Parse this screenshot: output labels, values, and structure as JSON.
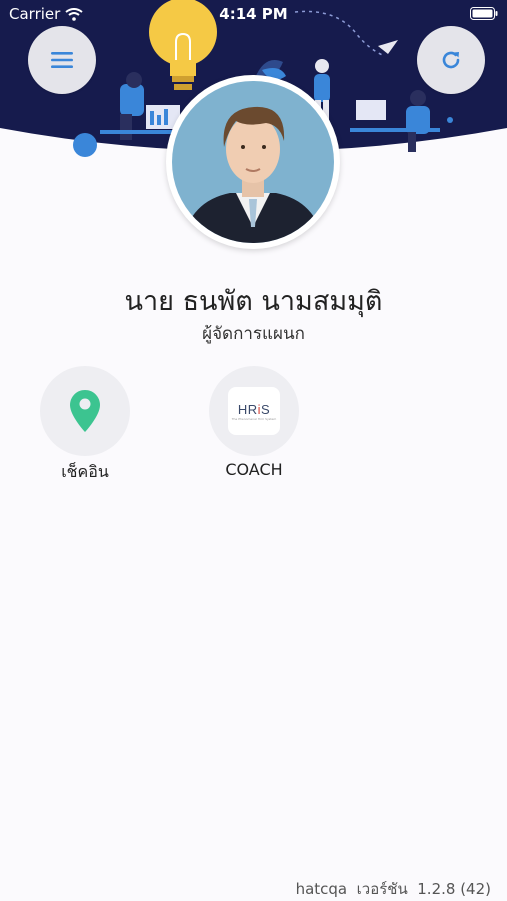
{
  "status_bar": {
    "carrier": "Carrier",
    "time": "4:14 PM"
  },
  "profile": {
    "name": "นาย ธนพัต นามสมมุติ",
    "position": "ผู้จัดการแผนก"
  },
  "menu": [
    {
      "label": "เช็คอิน",
      "icon": "location-pin-icon",
      "color": "#3cc490"
    },
    {
      "label": "COACH",
      "icon": "hris-logo",
      "logo_text": "HRiS",
      "logo_tagline": "The Phenomenal Hrm System"
    }
  ],
  "footer": {
    "app_name": "hatcqa",
    "version_label": "เวอร์ชัน",
    "version": "1.2.8 (42)"
  },
  "colors": {
    "header_bg": "#161b4d",
    "accent": "#3a86d9",
    "button_bg": "#e4e4ea",
    "bulb": "#f5c945"
  }
}
